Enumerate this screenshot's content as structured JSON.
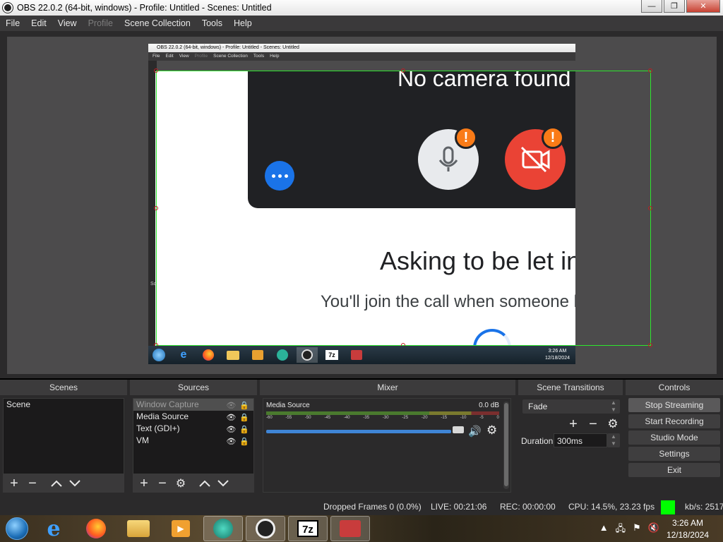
{
  "window": {
    "title": "OBS 22.0.2 (64-bit, windows) - Profile: Untitled - Scenes: Untitled",
    "minimize": "—",
    "maximize": "❐",
    "close": "✕"
  },
  "menu": [
    "File",
    "Edit",
    "View",
    "Profile",
    "Scene Collection",
    "Tools",
    "Help"
  ],
  "nested": {
    "title": "OBS 22.0.2 (64-bit, windows) - Profile: Untitled - Scenes: Untitled",
    "menu": [
      "File",
      "Edit",
      "View",
      "Profile",
      "Scene Collection",
      "Tools",
      "Help"
    ],
    "side_text": "Sc",
    "clock_time": "3:26 AM",
    "clock_date": "12/18/2024"
  },
  "capture": {
    "no_camera": "No camera found",
    "asking": "Asking to be let in",
    "subtitle": "You'll join the call when someone lets you in"
  },
  "docks": {
    "scenes": {
      "title": "Scenes",
      "items": [
        "Scene"
      ]
    },
    "sources": {
      "title": "Sources",
      "items": [
        {
          "label": "Window Capture",
          "selected": true
        },
        {
          "label": "Media Source",
          "selected": false
        },
        {
          "label": "Text (GDI+)",
          "selected": false
        },
        {
          "label": "VM",
          "selected": false
        }
      ]
    },
    "mixer": {
      "title": "Mixer",
      "track_name": "Media Source",
      "db": "0.0 dB",
      "ticks": [
        "-60",
        "-55",
        "-50",
        "-45",
        "-40",
        "-35",
        "-30",
        "-25",
        "-20",
        "-15",
        "-10",
        "-5",
        "0"
      ],
      "volume_level": 0.88
    },
    "transitions": {
      "title": "Scene Transitions",
      "selected": "Fade",
      "duration_label": "Duration",
      "duration_value": "300ms"
    },
    "controls": {
      "title": "Controls",
      "buttons": [
        "Stop Streaming",
        "Start Recording",
        "Studio Mode",
        "Settings",
        "Exit"
      ]
    }
  },
  "status": {
    "dropped": "Dropped Frames 0 (0.0%)",
    "live": "LIVE: 00:21:06",
    "rec": "REC: 00:00:00",
    "cpu": "CPU: 14.5%, 23.23 fps",
    "kbs": "kb/s: 2517",
    "indicator_color": "#00ff00"
  },
  "taskbar": {
    "time": "3:26 AM",
    "date": "12/18/2024",
    "apps": [
      "internet-explorer",
      "firefox",
      "file-explorer",
      "media-player",
      "vm-app",
      "obs",
      "7zip",
      "archive-app"
    ],
    "seven_zip_label": "7z"
  }
}
